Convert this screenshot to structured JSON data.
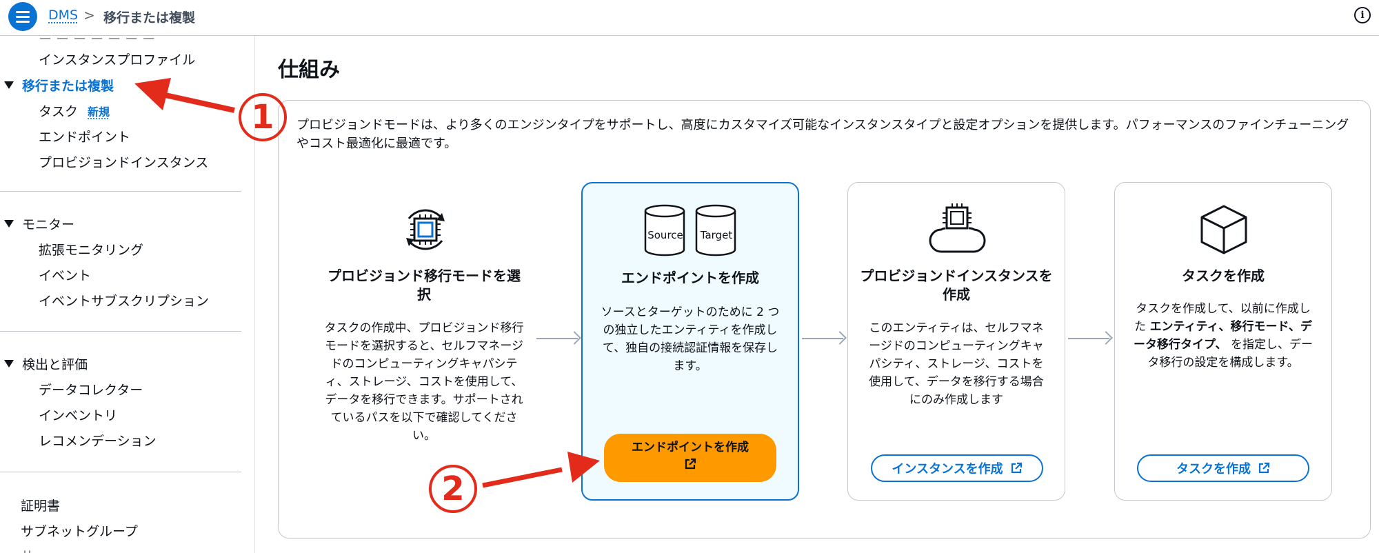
{
  "topbar": {
    "breadcrumb_home": "DMS",
    "breadcrumb_separator": ">",
    "breadcrumb_current": "移行または複製",
    "info_icon": "ⓘ"
  },
  "sidebar": {
    "items": [
      {
        "label": "インスタンスプロファイル"
      },
      {
        "label": "移行または複製"
      },
      {
        "label": "タスク",
        "badge": "新規"
      },
      {
        "label": "エンドポイント"
      },
      {
        "label": "プロビジョンドインスタンス"
      },
      {
        "label": "モニター"
      },
      {
        "label": "拡張モニタリング"
      },
      {
        "label": "イベント"
      },
      {
        "label": "イベントサブスクリプション"
      },
      {
        "label": "検出と評価"
      },
      {
        "label": "データコレクター"
      },
      {
        "label": "インベントリ"
      },
      {
        "label": "レコメンデーション"
      },
      {
        "label": "証明書"
      },
      {
        "label": "サブネットグループ"
      }
    ]
  },
  "main": {
    "title": "仕組み",
    "description": "プロビジョンドモードは、より多くのエンジンタイプをサポートし、高度にカスタマイズ可能なインスタンスタイプと設定オプションを提供します。パフォーマンスのファインチューニングやコスト最適化に最適です。",
    "steps": [
      {
        "icon": "chip-cycle-icon",
        "title": "プロビジョンド移行モードを選択",
        "description": "タスクの作成中、プロビジョンド移行モードを選択すると、セルフマネージドのコンピューティングキャパシティ、ストレージ、コストを使用して、データを移行できます。サポートされているパスを以下で確認してください。"
      },
      {
        "icon": "source-target-database-icon",
        "icon_labels": [
          "Source",
          "Target"
        ],
        "title": "エンドポイントを作成",
        "description": "ソースとターゲットのために 2 つの独立したエンティティを作成して、独自の接続認証情報を保存します。",
        "button": "エンドポイントを作成"
      },
      {
        "icon": "cloud-chip-icon",
        "title": "プロビジョンドインスタンスを作成",
        "description": "このエンティティは、セルフマネージドのコンピューティングキャパシティ、ストレージ、コストを使用して、データを移行する場合にのみ作成します",
        "button": "インスタンスを作成"
      },
      {
        "icon": "cube-icon",
        "title": "タスクを作成",
        "description_pre": "タスクを作成して、以前に作成した ",
        "description_bold": "エンティティ、移行モード、データ移行タイプ、",
        "description_post": " を指定し、データ移行の設定を構成します。",
        "button": "タスクを作成"
      }
    ]
  },
  "annotations": {
    "marker_1": "①",
    "marker_2": "②",
    "color": "#e22b1b"
  },
  "colors": {
    "accent": "#0972d3",
    "primary_button": "#ff9900",
    "highlight_bg": "#f0fbff"
  }
}
